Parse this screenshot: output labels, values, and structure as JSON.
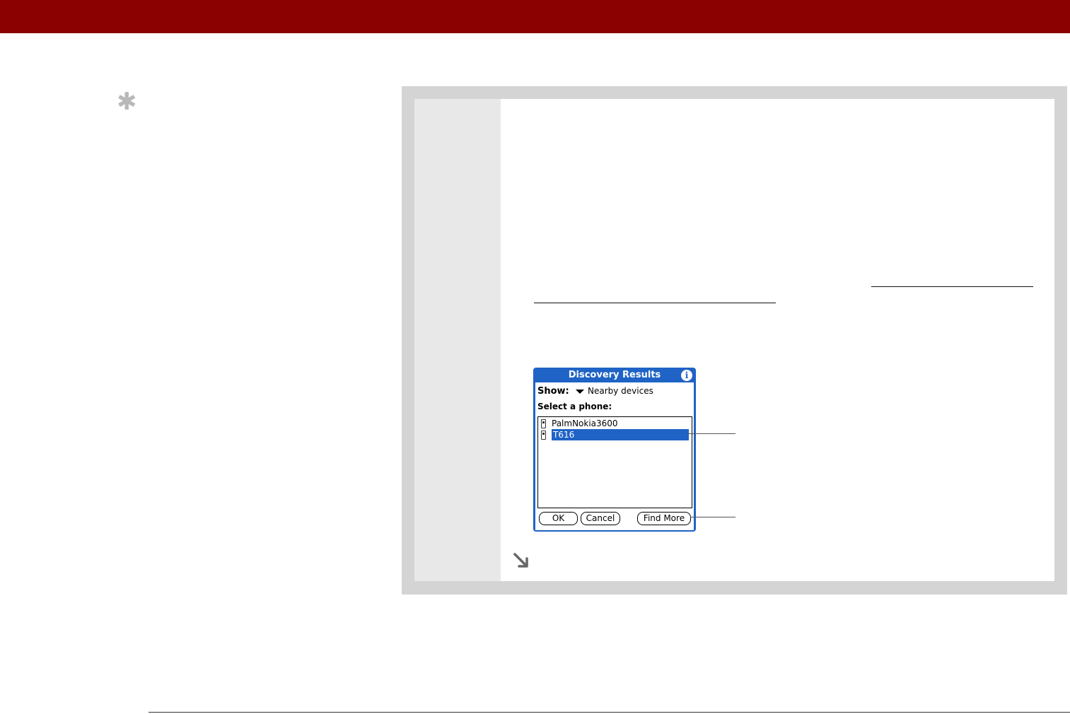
{
  "header": {
    "bar_color": "#8b0000"
  },
  "tip": {
    "icon": "asterisk-icon",
    "glyph": "✱"
  },
  "step": {
    "continue_icon": "continue-arrow-icon"
  },
  "dialog": {
    "title": "Discovery Results",
    "info_glyph": "i",
    "show_label": "Show:",
    "show_value": "Nearby devices",
    "select_label": "Select a phone:",
    "devices": [
      {
        "name": "PalmNokia3600",
        "selected": false
      },
      {
        "name": "T616",
        "selected": true
      }
    ],
    "buttons": {
      "ok": "OK",
      "cancel": "Cancel",
      "find_more": "Find More"
    },
    "accent_color": "#1f63c6"
  }
}
